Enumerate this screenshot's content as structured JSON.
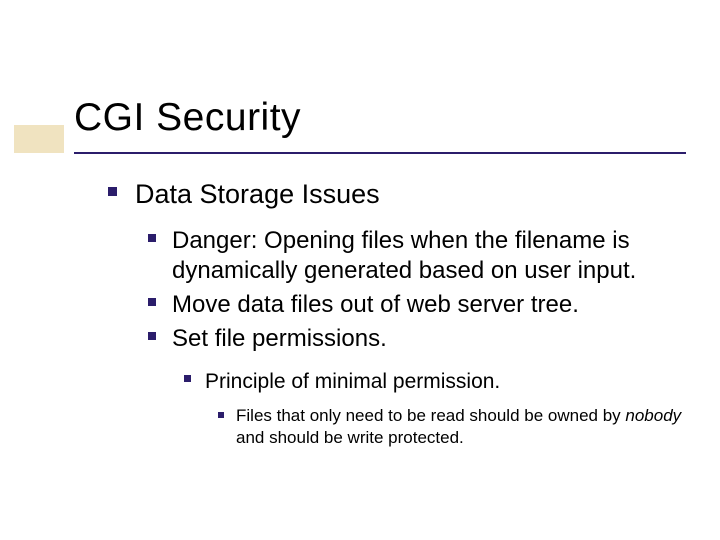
{
  "title": "CGI Security",
  "body": {
    "level1": [
      {
        "text": "Data Storage Issues",
        "children": [
          {
            "text": "Danger: Opening files when the filename is dynamically generated based on user input."
          },
          {
            "text": "Move data files out of web server tree."
          },
          {
            "text": "Set file permissions.",
            "children": [
              {
                "text": "Principle of minimal permission.",
                "children": [
                  {
                    "pre": "Files that only need to be read should be owned by ",
                    "em": "nobody",
                    "post": " and should be write protected."
                  }
                ]
              }
            ]
          }
        ]
      }
    ]
  }
}
